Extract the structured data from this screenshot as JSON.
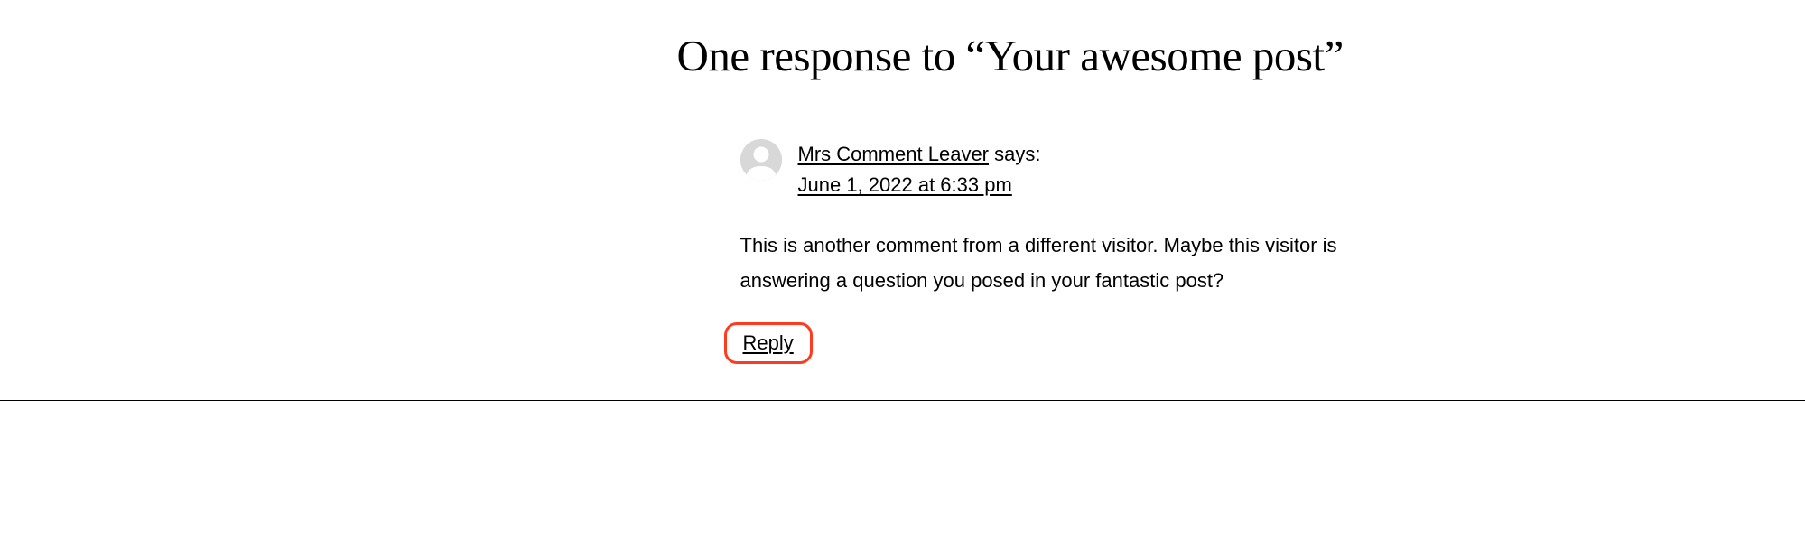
{
  "comments_section": {
    "title": "One response to “Your awesome post”"
  },
  "comment": {
    "author": "Mrs Comment Leaver",
    "says_label": "says:",
    "date": "June 1, 2022 at 6:33 pm",
    "body": "This is another comment from a different visitor. Maybe this visitor is answering a question you posed in your fantastic post?",
    "reply_label": "Reply"
  }
}
